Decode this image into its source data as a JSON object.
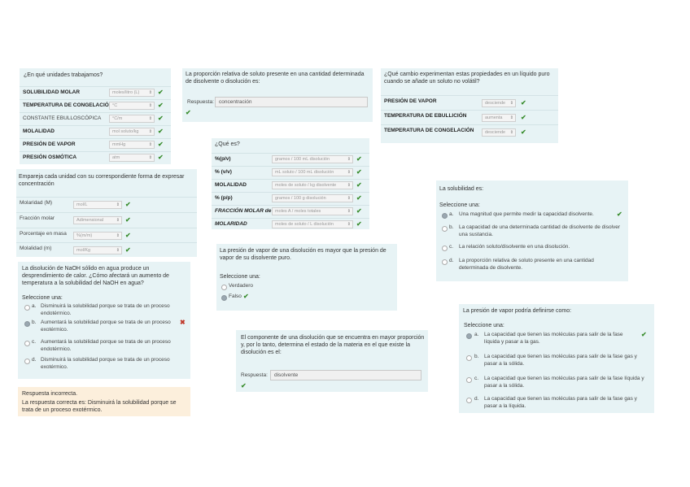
{
  "colors": {
    "card_bg": "#e7f3f5",
    "feedback_bg": "#fcefdc",
    "check": "#3a8d2f",
    "cross": "#c0392b"
  },
  "q1": {
    "title": "¿En qué unidades trabajamos?",
    "rows": [
      {
        "label": "SOLUBILIDAD MOLAR",
        "value": "moles/litro (L)"
      },
      {
        "label": "TEMPERATURA DE CONGELACIÓN",
        "value": "°C"
      },
      {
        "label": "CONSTANTE EBULLOSCÓPICA",
        "value": "°C/m"
      },
      {
        "label": "MOLALIDAD",
        "value": "mol soluto/kg"
      },
      {
        "label": "PRESIÓN DE VAPOR",
        "value": "mmHg"
      },
      {
        "label": "PRESIÓN OSMÓTICA",
        "value": "atm"
      }
    ]
  },
  "q2": {
    "title": "La proporción relativa de soluto presente en una cantidad determinada de disolvente o disolución es:",
    "answer_label": "Respuesta:",
    "answer_value": "concentración"
  },
  "q3": {
    "title": "¿Qué cambio experimentan estas propiedades en un líquido puro cuando se añade un soluto no volátil?",
    "rows": [
      {
        "label": "PRESIÓN DE VAPOR",
        "value": "desciende"
      },
      {
        "label": "TEMPERATURA DE EBULLICIÓN",
        "value": "aumenta"
      },
      {
        "label": "TEMPERATURA DE CONGELACIÓN",
        "value": "desciende"
      }
    ]
  },
  "q4": {
    "title": "¿Qué es?",
    "rows": [
      {
        "label": "%(p/v)",
        "value": "gramos / 100 mL disolución"
      },
      {
        "label": "% (v/v)",
        "value": "mL soluto / 100 mL disolución"
      },
      {
        "label": "MOLALIDAD",
        "value": "moles de soluto / kg disolvente"
      },
      {
        "label": "% (p/p)",
        "value": "gramos / 100 g disolución"
      },
      {
        "label": "FRACCIÓN MOLAR de A",
        "value": "moles A / moles totales"
      },
      {
        "label": "MOLARIDAD",
        "value": "moles de soluto / L disolución"
      }
    ]
  },
  "q5": {
    "title": "Empareja cada unidad con su correspondiente forma de expresar concentración",
    "rows": [
      {
        "label": "Molaridad (M)",
        "value": "mol/L"
      },
      {
        "label": "Fracción molar",
        "value": "Adimensional"
      },
      {
        "label": "Porcentaje en masa",
        "value": "%(m/m)"
      },
      {
        "label": "Molalidad (m)",
        "value": "mol/Kg"
      }
    ]
  },
  "q6": {
    "title": "La solubilidad es:",
    "select_label": "Seleccione una:",
    "options": [
      {
        "letter": "a.",
        "text": "Una magnitud que permite medir la capacidad disolvente.",
        "selected": true,
        "mark": "check"
      },
      {
        "letter": "b.",
        "text": "La capacidad de una determinada cantidad de disolvente de disolver una sustancia.",
        "selected": false,
        "mark": ""
      },
      {
        "letter": "c.",
        "text": "La relación soluto/disolvente en una disolución.",
        "selected": false,
        "mark": ""
      },
      {
        "letter": "d.",
        "text": "La proporción relativa de soluto presente en una cantidad determinada de disolvente.",
        "selected": false,
        "mark": ""
      }
    ]
  },
  "q7": {
    "title": "La presión de vapor de una disolución es mayor que la presión de vapor de su disolvente puro.",
    "select_label": "Seleccione una:",
    "options": [
      {
        "text": "Verdadero",
        "selected": false
      },
      {
        "text": "Falso",
        "selected": true
      }
    ]
  },
  "q8": {
    "title": "La disolución de NaOH sólido en agua produce un desprendimiento de calor. ¿Cómo afectará un aumento de temperatura a la solubilidad del NaOH en agua?",
    "select_label": "Seleccione una:",
    "options": [
      {
        "letter": "a.",
        "text": "Disminuirá la solubilidad porque se trata de un proceso endotérmico.",
        "selected": false,
        "mark": ""
      },
      {
        "letter": "b.",
        "text": "Aumentará la solubilidad porque se trata de un proceso exotérmico.",
        "selected": true,
        "mark": "cross"
      },
      {
        "letter": "c.",
        "text": "Aumentará la solubilidad porque se trata de un proceso endotérmico.",
        "selected": false,
        "mark": ""
      },
      {
        "letter": "d.",
        "text": "Disminuirá la solubilidad porque se trata de un proceso exotérmico.",
        "selected": false,
        "mark": ""
      }
    ],
    "feedback_title": "Respuesta incorrecta.",
    "feedback_text": "La respuesta correcta es: Disminuirá la solubilidad porque se trata de un proceso exotérmico."
  },
  "q9": {
    "title": "El componente de una disolución que se encuentra en mayor proporción y, por lo tanto, determina el estado de la materia en el que existe la disolución es el:",
    "answer_label": "Respuesta:",
    "answer_value": "disolvente"
  },
  "q10": {
    "title": "La presión de vapor podría definirse como:",
    "select_label": "Seleccione una:",
    "options": [
      {
        "letter": "a.",
        "text": "La capacidad que tienen las moléculas para salir de la fase líquida y pasar a la gas.",
        "selected": true,
        "mark": "check"
      },
      {
        "letter": "b.",
        "text": "La capacidad que tienen las moléculas para salir de la fase gas y pasar a la sólida.",
        "selected": false,
        "mark": ""
      },
      {
        "letter": "c.",
        "text": "La capacidad que tienen las moléculas para salir de la fase líquida y pasar a la sólida.",
        "selected": false,
        "mark": ""
      },
      {
        "letter": "d.",
        "text": "La capacidad que tienen las moléculas para salir de la fase gas y pasar a la líquida.",
        "selected": false,
        "mark": ""
      }
    ]
  }
}
